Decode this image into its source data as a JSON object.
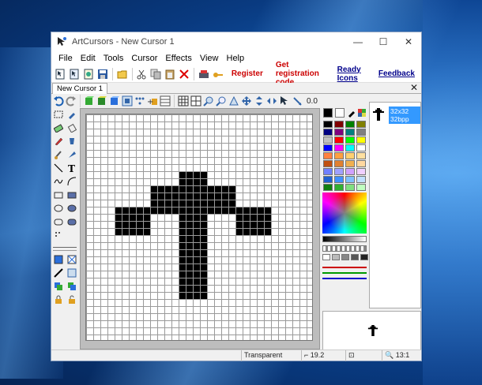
{
  "window": {
    "title": "ArtCursors - New Cursor 1",
    "controls": {
      "minimize": "—",
      "maximize": "☐",
      "close": "✕"
    }
  },
  "menu": [
    "File",
    "Edit",
    "Tools",
    "Cursor",
    "Effects",
    "View",
    "Help"
  ],
  "toolbar": {
    "register": "Register",
    "get_code": "Get registration code",
    "ready_icons": "Ready Icons",
    "feedback": "Feedback"
  },
  "tab": {
    "label": "New Cursor 1",
    "close": "✕"
  },
  "editbar": {
    "value": "0.0"
  },
  "preview": {
    "size": "32x32",
    "depth": "32bpp"
  },
  "status": {
    "mode": "Transparent",
    "coords": "19.2",
    "zoom": "13:1"
  },
  "colors": {
    "accent": "#3399ff",
    "register": "#cc0000",
    "link": "#00008b"
  },
  "palette_colors": [
    "#000000",
    "#800000",
    "#008000",
    "#808000",
    "#000080",
    "#800080",
    "#008080",
    "#808080",
    "#c0c0c0",
    "#ff0000",
    "#00ff00",
    "#ffff00",
    "#0000ff",
    "#ff00ff",
    "#00ffff",
    "#ffffff",
    "#ff8040",
    "#ffa040",
    "#ffd070",
    "#ffe0a0",
    "#c05010",
    "#e08030",
    "#f0b050",
    "#ffd8a0",
    "#7080ff",
    "#a0a0ff",
    "#d0a0ff",
    "#f0d0ff",
    "#2060d0",
    "#4090ff",
    "#80c0ff",
    "#c0e0ff",
    "#108010",
    "#30b030",
    "#80e080",
    "#c0ffc0"
  ],
  "cursor_pixels": [
    [
      13,
      8
    ],
    [
      14,
      8
    ],
    [
      15,
      8
    ],
    [
      16,
      8
    ],
    [
      13,
      9
    ],
    [
      14,
      9
    ],
    [
      15,
      9
    ],
    [
      16,
      9
    ],
    [
      9,
      10
    ],
    [
      10,
      10
    ],
    [
      11,
      10
    ],
    [
      12,
      10
    ],
    [
      13,
      10
    ],
    [
      14,
      10
    ],
    [
      15,
      10
    ],
    [
      16,
      10
    ],
    [
      17,
      10
    ],
    [
      18,
      10
    ],
    [
      19,
      10
    ],
    [
      20,
      10
    ],
    [
      9,
      11
    ],
    [
      10,
      11
    ],
    [
      11,
      11
    ],
    [
      12,
      11
    ],
    [
      13,
      11
    ],
    [
      14,
      11
    ],
    [
      15,
      11
    ],
    [
      16,
      11
    ],
    [
      17,
      11
    ],
    [
      18,
      11
    ],
    [
      19,
      11
    ],
    [
      20,
      11
    ],
    [
      9,
      12
    ],
    [
      10,
      12
    ],
    [
      11,
      12
    ],
    [
      12,
      12
    ],
    [
      13,
      12
    ],
    [
      14,
      12
    ],
    [
      15,
      12
    ],
    [
      16,
      12
    ],
    [
      17,
      12
    ],
    [
      18,
      12
    ],
    [
      19,
      12
    ],
    [
      20,
      12
    ],
    [
      4,
      13
    ],
    [
      5,
      13
    ],
    [
      6,
      13
    ],
    [
      7,
      13
    ],
    [
      8,
      13
    ],
    [
      9,
      13
    ],
    [
      10,
      13
    ],
    [
      11,
      13
    ],
    [
      12,
      13
    ],
    [
      13,
      13
    ],
    [
      14,
      13
    ],
    [
      15,
      13
    ],
    [
      16,
      13
    ],
    [
      17,
      13
    ],
    [
      18,
      13
    ],
    [
      19,
      13
    ],
    [
      20,
      13
    ],
    [
      21,
      13
    ],
    [
      22,
      13
    ],
    [
      23,
      13
    ],
    [
      24,
      13
    ],
    [
      25,
      13
    ],
    [
      4,
      14
    ],
    [
      5,
      14
    ],
    [
      6,
      14
    ],
    [
      7,
      14
    ],
    [
      8,
      14
    ],
    [
      13,
      14
    ],
    [
      14,
      14
    ],
    [
      15,
      14
    ],
    [
      16,
      14
    ],
    [
      21,
      14
    ],
    [
      22,
      14
    ],
    [
      23,
      14
    ],
    [
      24,
      14
    ],
    [
      25,
      14
    ],
    [
      4,
      15
    ],
    [
      5,
      15
    ],
    [
      6,
      15
    ],
    [
      7,
      15
    ],
    [
      8,
      15
    ],
    [
      13,
      15
    ],
    [
      14,
      15
    ],
    [
      15,
      15
    ],
    [
      16,
      15
    ],
    [
      21,
      15
    ],
    [
      22,
      15
    ],
    [
      23,
      15
    ],
    [
      24,
      15
    ],
    [
      25,
      15
    ],
    [
      4,
      16
    ],
    [
      5,
      16
    ],
    [
      6,
      16
    ],
    [
      7,
      16
    ],
    [
      8,
      16
    ],
    [
      13,
      16
    ],
    [
      14,
      16
    ],
    [
      15,
      16
    ],
    [
      16,
      16
    ],
    [
      21,
      16
    ],
    [
      22,
      16
    ],
    [
      23,
      16
    ],
    [
      24,
      16
    ],
    [
      25,
      16
    ],
    [
      13,
      17
    ],
    [
      14,
      17
    ],
    [
      15,
      17
    ],
    [
      16,
      17
    ],
    [
      13,
      18
    ],
    [
      14,
      18
    ],
    [
      15,
      18
    ],
    [
      16,
      18
    ],
    [
      13,
      19
    ],
    [
      14,
      19
    ],
    [
      15,
      19
    ],
    [
      16,
      19
    ],
    [
      13,
      20
    ],
    [
      14,
      20
    ],
    [
      15,
      20
    ],
    [
      16,
      20
    ],
    [
      13,
      21
    ],
    [
      14,
      21
    ],
    [
      15,
      21
    ],
    [
      16,
      21
    ],
    [
      13,
      22
    ],
    [
      14,
      22
    ],
    [
      15,
      22
    ],
    [
      16,
      22
    ],
    [
      13,
      23
    ],
    [
      14,
      23
    ],
    [
      15,
      23
    ],
    [
      16,
      23
    ],
    [
      13,
      24
    ],
    [
      14,
      24
    ],
    [
      15,
      24
    ],
    [
      16,
      24
    ],
    [
      13,
      25
    ],
    [
      14,
      25
    ],
    [
      15,
      25
    ],
    [
      16,
      25
    ]
  ]
}
